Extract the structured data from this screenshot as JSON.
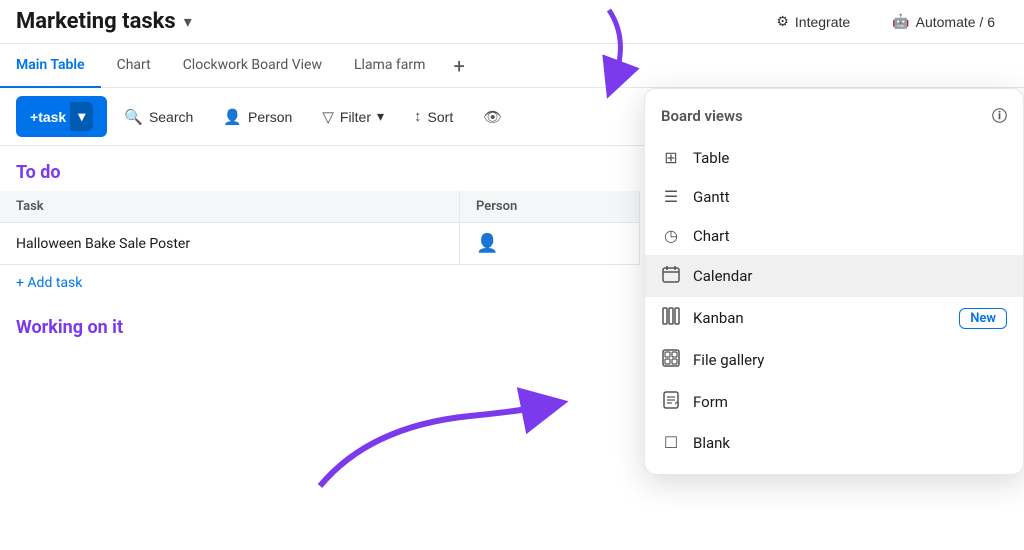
{
  "header": {
    "title": "rketing tasks",
    "title_prefix": "Ma",
    "dropdown_icon": "▾",
    "integrate_label": "Integrate",
    "automate_label": "Automate / 6"
  },
  "tabs": [
    {
      "id": "main-table",
      "label": "Main Table",
      "active": true
    },
    {
      "id": "chart",
      "label": "Chart",
      "active": false
    },
    {
      "id": "clockwork",
      "label": "Clockwork Board View",
      "active": false
    },
    {
      "id": "llama",
      "label": "Llama farm",
      "active": false
    },
    {
      "id": "add",
      "label": "+",
      "active": false
    }
  ],
  "toolbar": {
    "new_task_label": "task",
    "search_label": "Search",
    "person_label": "Person",
    "filter_label": "Filter",
    "sort_label": "Sort"
  },
  "sections": [
    {
      "id": "todo",
      "title": "To do",
      "columns": [
        "Task",
        "Person"
      ],
      "rows": [
        {
          "task": "Halloween Bake Sale Poster",
          "person": "👤"
        }
      ],
      "add_label": "+ Add task"
    },
    {
      "id": "working",
      "title": "Working on it"
    }
  ],
  "board_views_panel": {
    "title": "Board views",
    "info_icon": "ⓘ",
    "items": [
      {
        "id": "table",
        "icon": "⊞",
        "label": "Table",
        "badge": null
      },
      {
        "id": "gantt",
        "icon": "≡",
        "label": "Gantt",
        "badge": null
      },
      {
        "id": "chart",
        "icon": "◷",
        "label": "Chart",
        "badge": null
      },
      {
        "id": "calendar",
        "icon": "📅",
        "label": "Calendar",
        "badge": null,
        "active": true
      },
      {
        "id": "kanban",
        "icon": "⊟",
        "label": "Kanban",
        "badge": "New"
      },
      {
        "id": "file-gallery",
        "icon": "🖼",
        "label": "File gallery",
        "badge": null
      },
      {
        "id": "form",
        "icon": "📋",
        "label": "Form",
        "badge": null
      },
      {
        "id": "blank",
        "icon": "☐",
        "label": "Blank",
        "badge": null
      }
    ]
  }
}
